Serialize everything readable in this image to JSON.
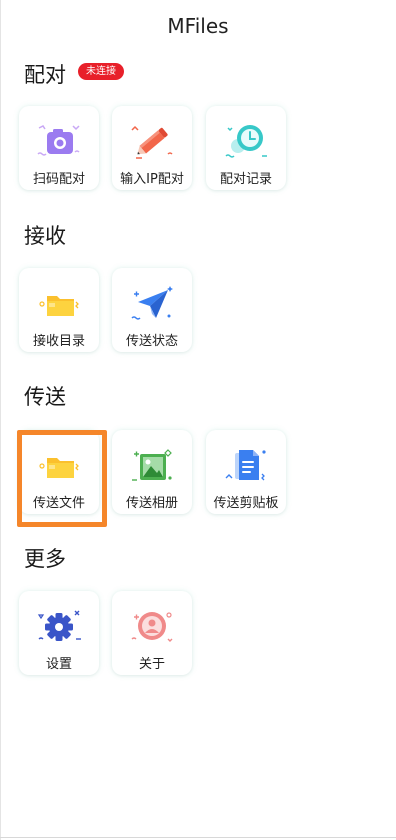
{
  "header": {
    "title": "MFiles"
  },
  "sections": {
    "pair": {
      "title": "配对",
      "status_badge": "未连接",
      "items": [
        {
          "label": "扫码配对",
          "icon": "camera-scan-icon"
        },
        {
          "label": "输入IP配对",
          "icon": "pencil-icon"
        },
        {
          "label": "配对记录",
          "icon": "clock-history-icon"
        }
      ]
    },
    "receive": {
      "title": "接收",
      "items": [
        {
          "label": "接收目录",
          "icon": "folder-icon"
        },
        {
          "label": "传送状态",
          "icon": "paper-plane-icon"
        }
      ]
    },
    "send": {
      "title": "传送",
      "items": [
        {
          "label": "传送文件",
          "icon": "folder-icon"
        },
        {
          "label": "传送相册",
          "icon": "image-icon"
        },
        {
          "label": "传送剪贴板",
          "icon": "document-icon"
        }
      ]
    },
    "more": {
      "title": "更多",
      "items": [
        {
          "label": "设置",
          "icon": "gear-icon"
        },
        {
          "label": "关于",
          "icon": "user-circle-icon"
        }
      ]
    }
  },
  "colors": {
    "badge": "#e8202a",
    "highlight": "#f5862a",
    "purple": "#9b7bf0",
    "orange": "#f2664a",
    "teal": "#37c8c8",
    "yellow": "#fbc02d",
    "blue": "#3a7ff0",
    "green": "#4caf50"
  }
}
